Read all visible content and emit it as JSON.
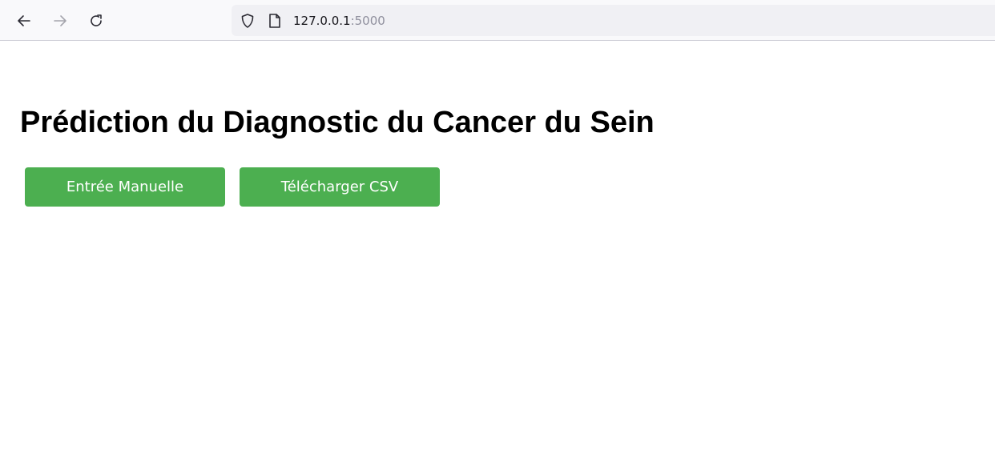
{
  "browser": {
    "url_host": "127.0.0.1",
    "url_port": ":5000"
  },
  "page": {
    "title": "Prédiction du Diagnostic du Cancer du Sein",
    "buttons": {
      "manual_label": "Entrée Manuelle",
      "csv_label": "Télécharger CSV"
    }
  },
  "icons": {
    "back": "arrow-left-icon",
    "forward": "arrow-right-icon",
    "reload": "reload-icon",
    "shield": "shield-icon",
    "page": "page-icon"
  },
  "colors": {
    "button_bg": "#4caf50",
    "button_text": "#ffffff",
    "toolbar_bg": "#f9f9fb",
    "urlbar_bg": "#f0f0f4"
  }
}
